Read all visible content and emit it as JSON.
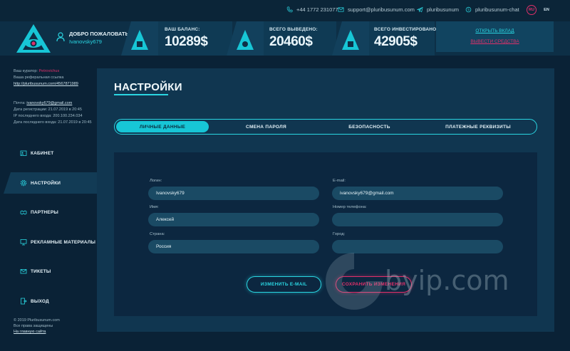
{
  "topbar": {
    "phone": "+44 1772 231077",
    "email": "support@pluribusunum.com",
    "telegram": "pluribusunum",
    "skype": "pluribusunum-chat",
    "lang_ru": "RU",
    "lang_en": "EN"
  },
  "header": {
    "welcome": "ДОБРО ПОЖАЛОВАТЬ,",
    "username": "Ivanovsky679",
    "stats": [
      {
        "label": "ВАШ БАЛАНС:",
        "value": "10289$"
      },
      {
        "label": "ВСЕГО ВЫВЕДЕНО:",
        "value": "20460$"
      },
      {
        "label": "ВСЕГО ИНВЕСТИРОВАНО:",
        "value": "42905$"
      }
    ],
    "open_deposit": "ОТКРЫТЬ ВКЛАД",
    "withdraw": "ВЫВЕСТИ СРЕДСТВА"
  },
  "sidebar": {
    "curator_label": "Ваш куратор:",
    "curator_name": "Petrovichus",
    "ref_label": "Ваша реферальная ссылка",
    "ref_link": "http://pluribusunum.com/4567871989",
    "mail_label": "Почта:",
    "mail_value": "ivanovsky679@gmail.com",
    "reg_date": "Дата регистрации: 21.07.2019 в 20:45",
    "last_ip": "IP последнего входа: 200.100.234.034",
    "last_login": "Дата последнего входа: 21.07.2019 в 20:45",
    "nav": [
      {
        "label": "КАБИНЕТ",
        "icon": "cabinet-icon"
      },
      {
        "label": "НАСТРОЙКИ",
        "icon": "gear-icon"
      },
      {
        "label": "ПАРТНЕРЫ",
        "icon": "partners-icon"
      },
      {
        "label": "РЕКЛАМНЫЕ МАТЕРИАЛЫ",
        "icon": "promo-icon"
      },
      {
        "label": "ТИКЕТЫ",
        "icon": "tickets-icon"
      },
      {
        "label": "ВЫХОД",
        "icon": "logout-icon"
      }
    ],
    "footer_copy": "© 2019 Pluribusunum.com",
    "footer_rights": "Все права защищены",
    "footer_link": "На главную сайта"
  },
  "main": {
    "title": "НАСТРОЙКИ",
    "tabs": [
      {
        "label": "ЛИЧНЫЕ ДАННЫЕ"
      },
      {
        "label": "СМЕНА ПАРОЛЯ"
      },
      {
        "label": "БЕЗОПАСНОСТЬ"
      },
      {
        "label": "ПЛАТЕЖНЫЕ РЕКВИЗИТЫ"
      }
    ],
    "fields": {
      "login_label": "Логин:",
      "login_value": "Ivanovsky679",
      "email_label": "E-mail:",
      "email_value": "ivanovsky679@gmail.com",
      "name_label": "Имя:",
      "name_value": "Алексей",
      "phone_label": "Номер телефона:",
      "phone_value": "",
      "country_label": "Страна:",
      "country_value": "Россия",
      "city_label": "Город:",
      "city_value": ""
    },
    "change_email": "ИЗМЕНИТЬ E-MAIL",
    "save_changes": "СОХРАНИТЬ ИЗМЕНЕНИЯ"
  },
  "watermark": "byip.com",
  "colors": {
    "accent": "#2ad6e2",
    "danger": "#e0306a",
    "bg": "#0a2236",
    "panel": "#103650"
  }
}
